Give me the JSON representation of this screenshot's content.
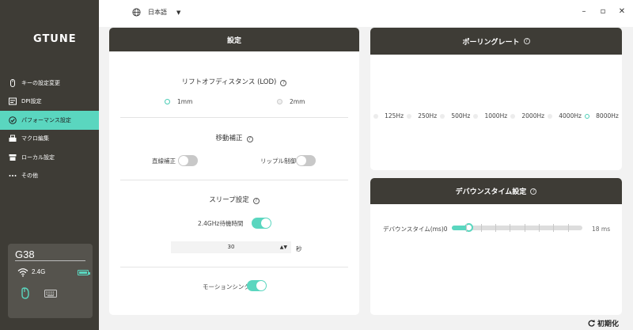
{
  "brand": "GTUNE",
  "language": "日本語",
  "nav": [
    {
      "label": "キーの設定変更",
      "icon": "mouse-icon"
    },
    {
      "label": "DPI設定",
      "icon": "dpi-icon"
    },
    {
      "label": "パフォーマンス設定",
      "icon": "performance-icon",
      "active": true
    },
    {
      "label": "マクロ編集",
      "icon": "macro-icon"
    },
    {
      "label": "ローカル設定",
      "icon": "local-icon"
    },
    {
      "label": "その他",
      "icon": "more-icon"
    }
  ],
  "device": {
    "model": "G38",
    "connection": "2.4G",
    "battery": 1.0
  },
  "settings": {
    "title": "設定",
    "lod": {
      "title": "リフトオフディスタンス (LOD)",
      "options": [
        "1mm",
        "2mm"
      ],
      "selected": "1mm"
    },
    "motion": {
      "title": "移動補正",
      "straight_label": "直線補正",
      "straight_on": false,
      "ripple_label": "リップル制御",
      "ripple_on": false
    },
    "sleep": {
      "title": "スリープ設定",
      "wait_label": "2.4GHz待機時間",
      "wait_on": true,
      "value": "30",
      "unit": "秒"
    },
    "motion_sync": {
      "label": "モーションシンク",
      "on": true
    }
  },
  "polling": {
    "title": "ポーリングレート",
    "rates": [
      "125Hz",
      "250Hz",
      "500Hz",
      "1000Hz",
      "2000Hz",
      "4000Hz",
      "8000Hz"
    ],
    "selected": "8000Hz"
  },
  "debounce": {
    "title": "デバウンスタイム設定",
    "label": "デバウンスタイム(ms)",
    "min": "0",
    "max": "18 ms",
    "value": 2,
    "range": [
      0,
      18
    ]
  },
  "reset_label": "初期化",
  "colors": {
    "accent": "#5ad6bf",
    "sidebar": "#3e3c36"
  }
}
